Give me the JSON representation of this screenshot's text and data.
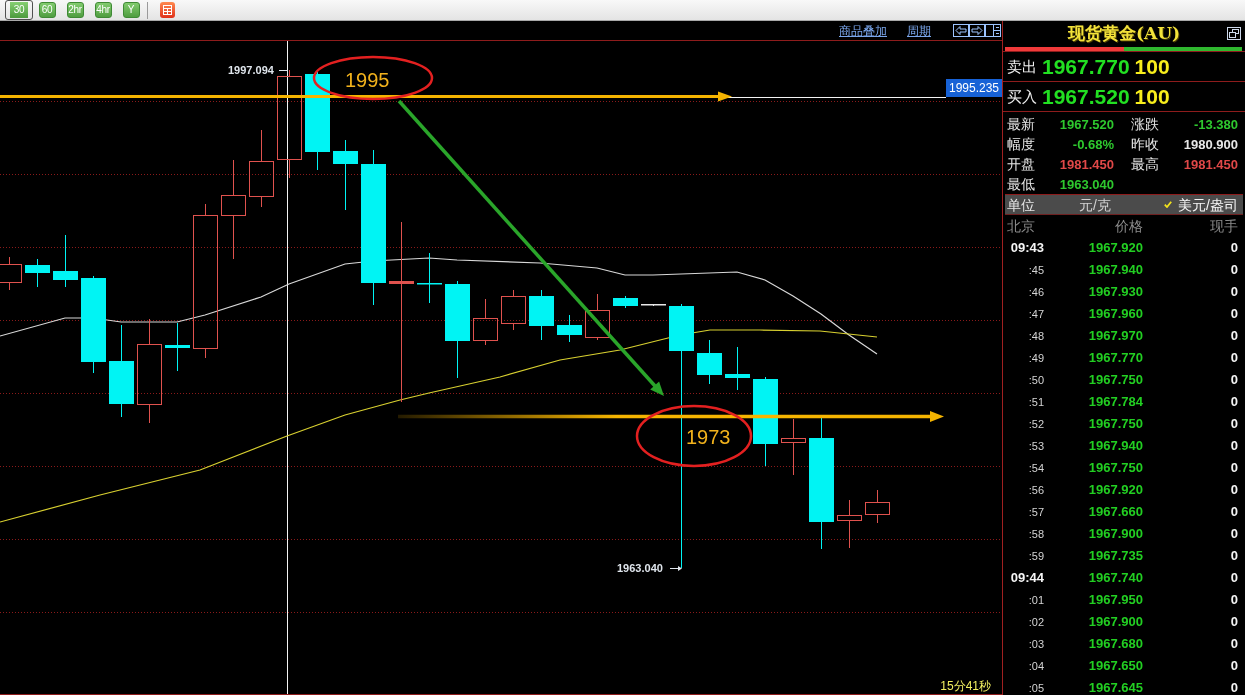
{
  "toolbar": {
    "period_buttons": [
      {
        "label": "30",
        "selected": true
      },
      {
        "label": "60",
        "selected": false
      },
      {
        "label": "2hr",
        "selected": false
      },
      {
        "label": "4hr",
        "selected": false
      },
      {
        "label": "Y",
        "selected": false
      }
    ]
  },
  "chart": {
    "header_links": [
      "商品叠加",
      "周期"
    ],
    "crosshair_price": "1995.235",
    "high_marker": "1997.094",
    "low_marker": "1963.040",
    "annotations": [
      "1995",
      "1973"
    ],
    "countdown": "15分41秒"
  },
  "quote_panel": {
    "title": "现货黄金(AU)",
    "ratio_bar": {
      "level": 0.5
    },
    "orders": [
      {
        "label": "卖出",
        "price": "1967.770",
        "volume": "100"
      },
      {
        "label": "买入",
        "price": "1967.520",
        "volume": "100"
      }
    ],
    "stats": [
      {
        "label": "最新",
        "value": "1967.520",
        "color": "#2ec82e"
      },
      {
        "label": "涨跌",
        "value": "-13.380",
        "color": "#2ec82e"
      },
      {
        "label": "幅度",
        "value": "-0.68%",
        "color": "#2ec82e"
      },
      {
        "label": "昨收",
        "value": "1980.900",
        "color": "#e8e8e8"
      },
      {
        "label": "开盘",
        "value": "1981.450",
        "color": "#e04848"
      },
      {
        "label": "最高",
        "value": "1981.450",
        "color": "#e04848"
      },
      {
        "label": "最低",
        "value": "1963.040",
        "color": "#2ec82e"
      }
    ],
    "units": {
      "label": "单位",
      "options": [
        {
          "label": "元/克",
          "selected": false
        },
        {
          "label": "美元/盎司",
          "selected": true
        }
      ]
    },
    "ticks": {
      "columns": [
        "北京",
        "价格",
        "现手"
      ],
      "rows": [
        {
          "kind": "minute",
          "time": "09:43",
          "price": "1967.920",
          "volume": "0"
        },
        {
          "kind": "second",
          "time": ":45",
          "price": "1967.940",
          "volume": "0"
        },
        {
          "kind": "second",
          "time": ":46",
          "price": "1967.930",
          "volume": "0"
        },
        {
          "kind": "second",
          "time": ":47",
          "price": "1967.960",
          "volume": "0"
        },
        {
          "kind": "second",
          "time": ":48",
          "price": "1967.970",
          "volume": "0"
        },
        {
          "kind": "second",
          "time": ":49",
          "price": "1967.770",
          "volume": "0"
        },
        {
          "kind": "second",
          "time": ":50",
          "price": "1967.750",
          "volume": "0"
        },
        {
          "kind": "second",
          "time": ":51",
          "price": "1967.784",
          "volume": "0"
        },
        {
          "kind": "second",
          "time": ":52",
          "price": "1967.750",
          "volume": "0"
        },
        {
          "kind": "second",
          "time": ":53",
          "price": "1967.940",
          "volume": "0"
        },
        {
          "kind": "second",
          "time": ":54",
          "price": "1967.750",
          "volume": "0"
        },
        {
          "kind": "second",
          "time": ":56",
          "price": "1967.920",
          "volume": "0"
        },
        {
          "kind": "second",
          "time": ":57",
          "price": "1967.660",
          "volume": "0"
        },
        {
          "kind": "second",
          "time": ":58",
          "price": "1967.900",
          "volume": "0"
        },
        {
          "kind": "second",
          "time": ":59",
          "price": "1967.735",
          "volume": "0"
        },
        {
          "kind": "minute",
          "time": "09:44",
          "price": "1967.740",
          "volume": "0"
        },
        {
          "kind": "second",
          "time": ":01",
          "price": "1967.950",
          "volume": "0"
        },
        {
          "kind": "second",
          "time": ":02",
          "price": "1967.900",
          "volume": "0"
        },
        {
          "kind": "second",
          "time": ":03",
          "price": "1967.680",
          "volume": "0"
        },
        {
          "kind": "second",
          "time": ":04",
          "price": "1967.650",
          "volume": "0"
        },
        {
          "kind": "second",
          "time": ":05",
          "price": "1967.645",
          "volume": "0"
        }
      ]
    }
  }
}
